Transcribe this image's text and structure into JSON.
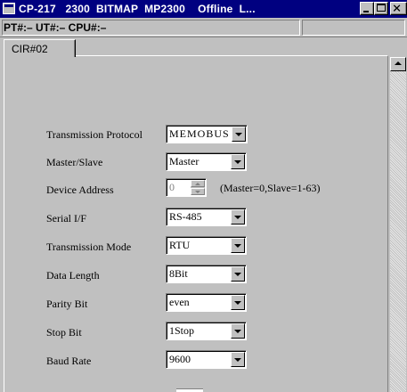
{
  "window": {
    "title": "CP-217   2300  BITMAP  MP2300    Offline  L...",
    "title_bar_color": "#000080"
  },
  "status": {
    "text": "PT#:– UT#:– CPU#:–"
  },
  "tabs": [
    {
      "label": "CIR#02",
      "active": true
    }
  ],
  "form": {
    "transmission_protocol": {
      "label": "Transmission Protocol",
      "value": "MEMOBUS"
    },
    "master_slave": {
      "label": "Master/Slave",
      "value": "Master"
    },
    "device_address": {
      "label": "Device Address",
      "value": "0",
      "hint": "(Master=0,Slave=1-63)"
    },
    "serial_if": {
      "label": "Serial I/F",
      "value": "RS-485"
    },
    "transmission_mode": {
      "label": "Transmission Mode",
      "value": "RTU"
    },
    "data_length": {
      "label": "Data Length",
      "value": "8Bit"
    },
    "parity_bit": {
      "label": "Parity Bit",
      "value": "even"
    },
    "stop_bit": {
      "label": "Stop Bit",
      "value": "1Stop"
    },
    "baud_rate": {
      "label": "Baud Rate",
      "value": "9600"
    }
  }
}
